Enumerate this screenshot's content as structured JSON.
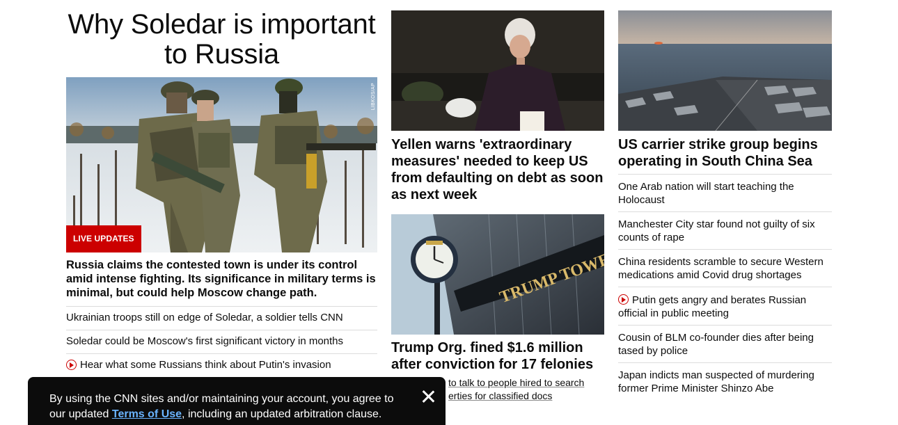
{
  "lead": {
    "title": "Why Soledar is important to Russia",
    "badge": "LIVE UPDATES",
    "photo_credit": "LIBKOS/AP",
    "summary": "Russia claims the contested town is under its control amid intense fighting. Its significance in military terms is minimal, but could help Moscow change path.",
    "links": [
      {
        "text": "Ukrainian troops still on edge of Soledar, a soldier tells CNN",
        "video": false
      },
      {
        "text": "Soledar could be Moscow's first significant victory in months",
        "video": false
      },
      {
        "text": "Hear what some Russians think about Putin's invasion",
        "video": true
      }
    ]
  },
  "middle": {
    "story1": {
      "headline": "Yellen warns 'extraordinary measures' needed to keep US from defaulting on debt as soon as next week"
    },
    "story2": {
      "headline": "Trump Org. fined $1.6 million after conviction for 17 felonies",
      "sign_text": "TRUMP TOWER",
      "sublink_line1": "to talk to people hired to search",
      "sublink_line2": "erties for classified docs"
    }
  },
  "right": {
    "story": {
      "headline": "US carrier strike group begins operating in South China Sea"
    },
    "links": [
      {
        "text": "One Arab nation will start teaching the Holocaust",
        "video": false
      },
      {
        "text": "Manchester City star found not guilty of six counts of rape",
        "video": false
      },
      {
        "text": "China residents scramble to secure Western medications amid Covid drug shortages",
        "video": false
      },
      {
        "text": "Putin gets angry and berates Russian official in public meeting",
        "video": true
      },
      {
        "text": "Cousin of BLM co-founder dies after being tased by police",
        "video": false
      },
      {
        "text": "Japan indicts man suspected of murdering former Prime Minister Shinzo Abe",
        "video": false
      }
    ]
  },
  "consent": {
    "text_before": "By using the CNN sites and/or maintaining your account, you agree to our updated ",
    "link": "Terms of Use",
    "text_after": ", including an updated arbitration clause."
  }
}
